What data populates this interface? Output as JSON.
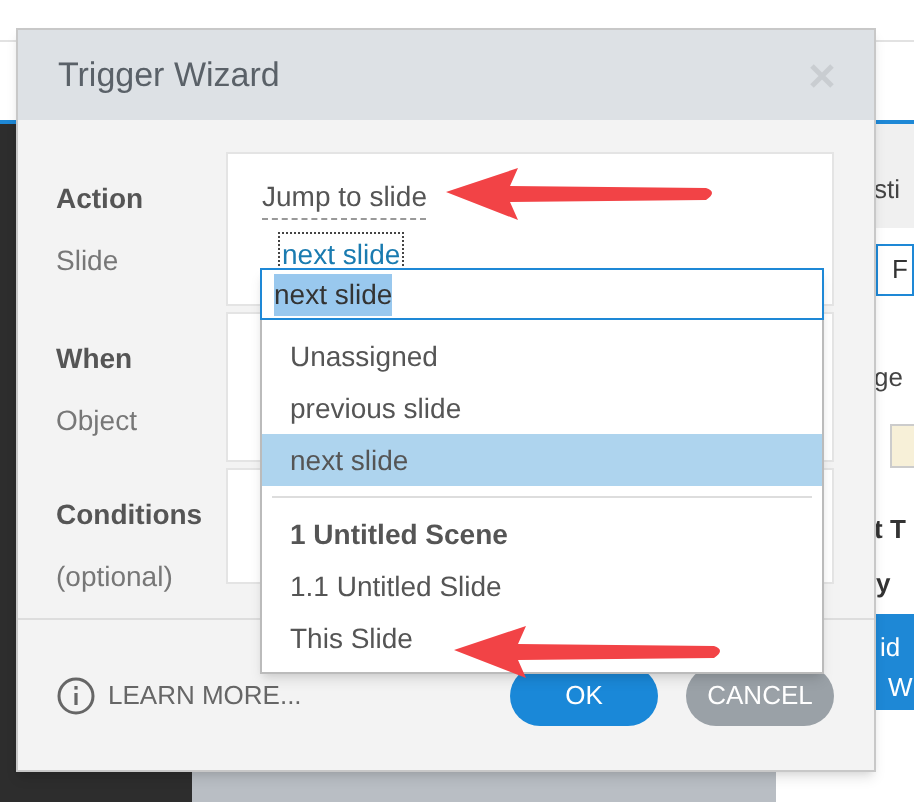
{
  "background": {
    "texts": [
      {
        "kind": "plain",
        "text": "sti"
      },
      {
        "kind": "field",
        "text": "F"
      },
      {
        "kind": "plain",
        "text": "ge"
      },
      {
        "kind": "bold",
        "text": "t T"
      },
      {
        "kind": "bold",
        "text": "y"
      },
      {
        "kind": "inverse",
        "text": "id"
      },
      {
        "kind": "inverse",
        "text": "W"
      }
    ]
  },
  "dialog": {
    "title": "Trigger Wizard",
    "sections": [
      {
        "title": "Action",
        "value": "Jump to slide",
        "sub_label": "Slide",
        "sub_value": "next slide"
      },
      {
        "title": "When",
        "sub_label": "Object"
      },
      {
        "title": "Conditions",
        "sub_label": "(optional)"
      }
    ],
    "dropdown": {
      "input": "next slide",
      "items": [
        {
          "kind": "option",
          "label": "Unassigned",
          "selected": false
        },
        {
          "kind": "option",
          "label": "previous slide",
          "selected": false
        },
        {
          "kind": "option",
          "label": "next slide",
          "selected": true
        },
        {
          "kind": "group",
          "label": "1 Untitled Scene",
          "selected": false
        },
        {
          "kind": "option",
          "label": "1.1 Untitled Slide",
          "selected": false
        },
        {
          "kind": "option",
          "label": "This Slide",
          "selected": false
        }
      ]
    },
    "learn_more": "LEARN MORE...",
    "buttons": [
      {
        "kind": "primary",
        "label": "OK"
      },
      {
        "kind": "secondary",
        "label": "CANCEL"
      }
    ]
  }
}
